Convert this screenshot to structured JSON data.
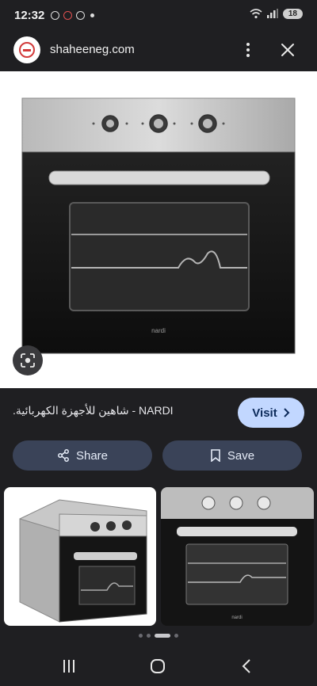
{
  "status_bar": {
    "time": "12:32",
    "battery": "18"
  },
  "header": {
    "site": "shaheeneg.com",
    "menu_icon": "more-vert-icon",
    "close_icon": "close-icon"
  },
  "hero": {
    "brand_text": "nardi",
    "icon": "google-lens-icon"
  },
  "result": {
    "title": "NARDI - شاهين للأجهزة الكهربائية.",
    "visit_label": "Visit",
    "visit_icon": "chevron-right-icon"
  },
  "actions": {
    "share_label": "Share",
    "share_icon": "share-icon",
    "save_label": "Save",
    "save_icon": "bookmark-icon"
  },
  "thumbnails": [
    {
      "alt_icon": "oven-photo-side"
    },
    {
      "alt_icon": "oven-photo-front"
    }
  ],
  "nav": {
    "recents_icon": "recents-icon",
    "home_icon": "home-icon",
    "back_icon": "back-icon"
  },
  "colors": {
    "background": "#1f1f22",
    "visit_bg": "#c2d7ff",
    "pill_bg": "#3a4358"
  }
}
